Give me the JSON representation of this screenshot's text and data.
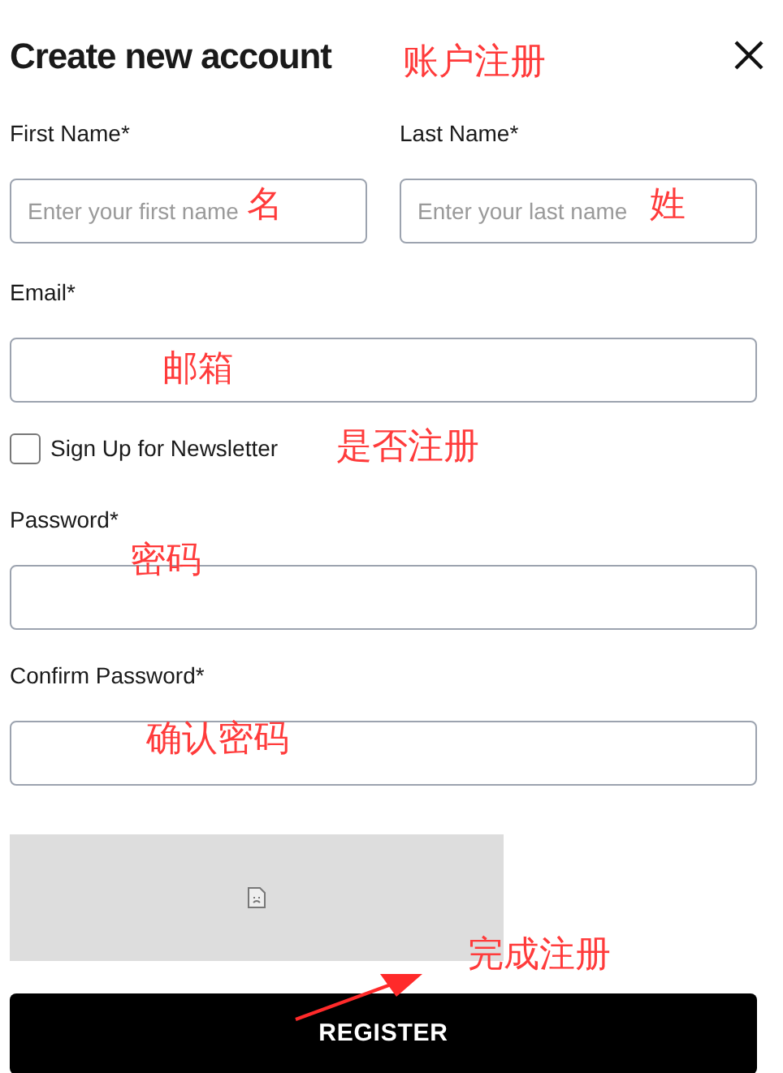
{
  "title": "Create new account",
  "name_fields": [
    {
      "label": "First Name*",
      "placeholder": "Enter your first name"
    },
    {
      "label": "Last Name*",
      "placeholder": "Enter your last name"
    }
  ],
  "form": [
    {
      "kind": "input",
      "label": "Email*"
    },
    {
      "kind": "checkbox",
      "label": "Sign Up for Newsletter",
      "checked": false
    },
    {
      "kind": "input",
      "label": "Password*"
    },
    {
      "kind": "input",
      "label": "Confirm Password*"
    }
  ],
  "button": "REGISTER",
  "annotations": [
    "账户注册",
    "名",
    "姓",
    "邮箱",
    "是否注册",
    "密码",
    "确认密码",
    "完成注册"
  ]
}
